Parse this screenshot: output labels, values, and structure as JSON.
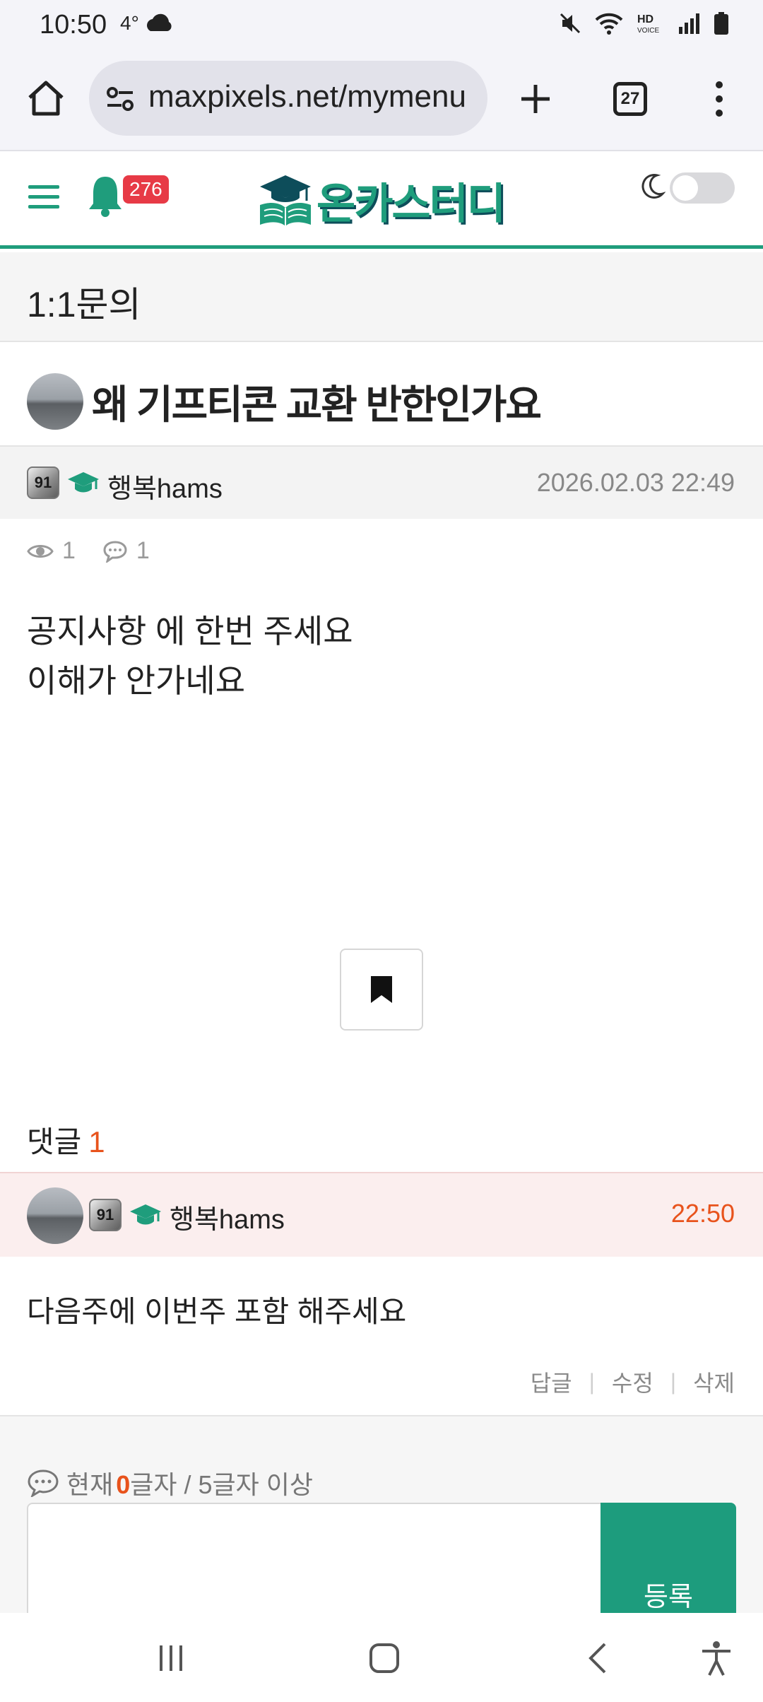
{
  "status_bar": {
    "time": "10:50",
    "temp": "4°"
  },
  "browser": {
    "url": "maxpixels.net/mymenu",
    "tab_count": "27"
  },
  "site": {
    "notification_count": "276",
    "logo_text": "온카스터디",
    "accent_color": "#1f9d7c"
  },
  "board": {
    "title": "1:1문의"
  },
  "post": {
    "title": "왜 기프티콘 교환 반한인가요",
    "author_level": "91",
    "author": "행복hams",
    "date": "2026.02.03 22:49",
    "views": "1",
    "comment_count": "1",
    "body_lines": [
      "공지사항 에 한번 주세요",
      "이해가 안가네요"
    ]
  },
  "comments": {
    "heading": "댓글",
    "count": "1",
    "items": [
      {
        "author_level": "91",
        "author": "행복hams",
        "time": "22:50",
        "body": "다음주에 이번주 포함 해주세요",
        "actions": [
          "답글",
          "수정",
          "삭제"
        ]
      }
    ]
  },
  "comment_form": {
    "prefix": "현재",
    "current": "0",
    "suffix": "글자 / 5글자 이상",
    "submit_label": "등록",
    "value": ""
  }
}
